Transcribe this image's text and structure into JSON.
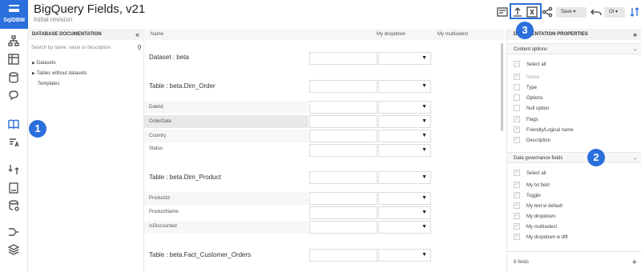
{
  "app": {
    "logo": "SqlDBM",
    "title": "BigQuery Fields, v21",
    "subtitle": "Initial revision"
  },
  "header": {
    "save_label": "Save ▾",
    "owner": "OI ▾",
    "badges": [
      "1",
      "2",
      "3"
    ]
  },
  "left_panel": {
    "title": "DATABASE DOCUMENTATION",
    "collapse": "«",
    "search_placeholder": "Search by name, value or description",
    "tree": [
      "Datasets",
      "Tables without datasets",
      "Templates"
    ]
  },
  "grid": {
    "columns": [
      "Name",
      "My dropdown",
      "My multiselect"
    ],
    "sections": [
      {
        "title": "Dataset : beta",
        "rows": []
      },
      {
        "title": "Table : beta.Dim_Order",
        "rows": [
          "DateId",
          "OrderDate",
          "Country",
          "Status"
        ]
      },
      {
        "title": "Table : beta.Dim_Product",
        "rows": [
          "ProductId",
          "ProductName",
          "IsDiscounted"
        ]
      },
      {
        "title": "Table : beta.Fact_Customer_Orders",
        "rows": []
      }
    ]
  },
  "right_panel": {
    "title": "DOCUMENTATION PROPERTIES",
    "collapse": "»",
    "content_options": {
      "title": "Content options",
      "select_all": "Select all",
      "items": [
        {
          "label": "Name",
          "checked": true,
          "disabled": true
        },
        {
          "label": "Type",
          "checked": false
        },
        {
          "label": "Options",
          "checked": false
        },
        {
          "label": "Null option",
          "checked": false
        },
        {
          "label": "Flags",
          "checked": true
        },
        {
          "label": "Friendly/Logical name",
          "checked": true
        },
        {
          "label": "Description",
          "checked": true
        }
      ]
    },
    "governance": {
      "title": "Data governance fields",
      "select_all": "Select all",
      "items": [
        "My txt field",
        "Toggle",
        "My text w default",
        "My dropdown",
        "My multiselect",
        "My dropdown w dflt"
      ]
    },
    "footer": "6 fields",
    "footer_add": "+"
  },
  "colors": {
    "accent": "#2a6fdb"
  }
}
